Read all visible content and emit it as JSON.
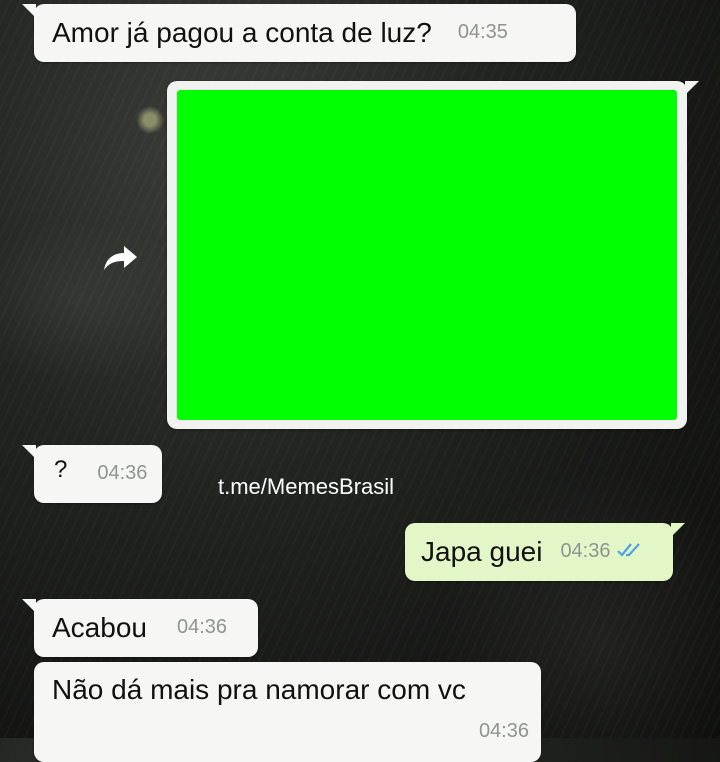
{
  "chat": {
    "messages": [
      {
        "text": "Amor já pagou a conta de luz?",
        "time": "04:35",
        "direction": "incoming"
      },
      {
        "media": "green-screen-image",
        "forwarded": true,
        "direction": "outgoing"
      },
      {
        "text": "?",
        "time": "04:36",
        "direction": "incoming"
      },
      {
        "text": "Japa guei",
        "time": "04:36",
        "direction": "outgoing",
        "status": "read-double-check"
      },
      {
        "text": "Acabou",
        "time": "04:36",
        "direction": "incoming"
      },
      {
        "text": "Não dá mais pra namorar com vc",
        "time": "04:36",
        "direction": "incoming"
      }
    ]
  },
  "watermark": "t.me/MemesBrasil",
  "colors": {
    "incoming_bubble": "#f6f6f4",
    "outgoing_bubble": "#e3f6c8",
    "media_fill": "#00ff00",
    "read_ticks": "#4fa3e0"
  },
  "icons": {
    "forward": "forward-arrow-icon",
    "read": "double-check-icon"
  }
}
